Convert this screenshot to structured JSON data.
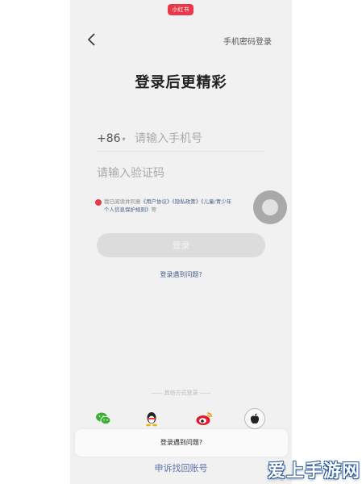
{
  "header": {
    "brand_badge": "小红书",
    "back_icon": "chevron-left-icon",
    "password_login_label": "手机密码登录"
  },
  "main": {
    "title": "登录后更精彩",
    "country_code": "+86",
    "phone_placeholder": "请输入手机号",
    "code_placeholder": "请输入验证码",
    "agreement": {
      "prefix": "我已阅读并同意",
      "link1": "《用户协议》",
      "link2": "《隐私政策》",
      "link3": "《儿童/青少年",
      "line2_link": "个人信息保护规则》",
      "suffix": "等"
    },
    "login_button_label": "登录",
    "help_link": "登录遇到问题?"
  },
  "footer": {
    "other_methods_label": "其他方式登录",
    "social_icons": [
      "wechat-icon",
      "qq-icon",
      "weibo-icon",
      "apple-icon"
    ],
    "sheet_label": "登录遇到问题?",
    "appeal_link": "申诉找回账号"
  },
  "watermark": "爱上手游网",
  "colors": {
    "accent": "#e8394a",
    "link": "#4a5f8c",
    "background": "#f1f1f1",
    "button_disabled": "#dcdcdc"
  }
}
